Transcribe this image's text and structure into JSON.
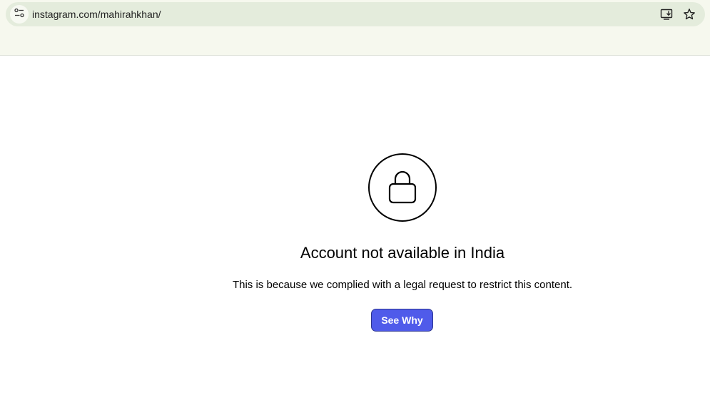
{
  "browser": {
    "url": "instagram.com/mahirahkhan/",
    "icons": {
      "site_info": "tune-icon",
      "install": "install-app-icon",
      "bookmark": "star-icon"
    }
  },
  "page": {
    "icon": "lock-icon",
    "title": "Account not available in India",
    "message": "This is because we complied with a legal request to restrict this content.",
    "button_label": "See Why",
    "colors": {
      "button": "#4f5bea",
      "chrome_background": "#f6f8ee",
      "omnibox_background": "#e4ecdc"
    }
  }
}
